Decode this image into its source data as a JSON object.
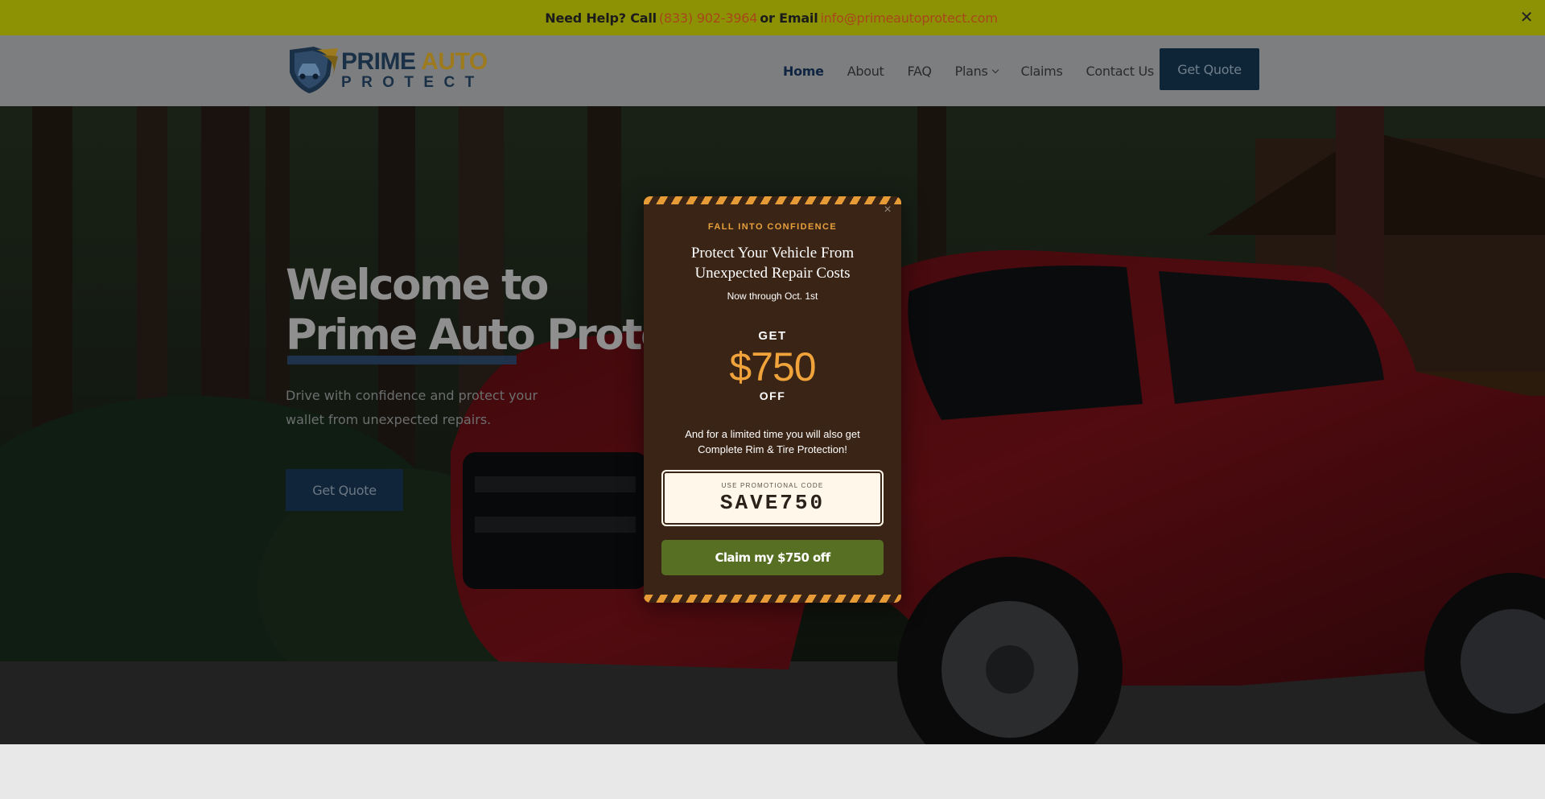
{
  "topbar": {
    "need_help": "Need Help? Call",
    "phone": "(833) 902-3964",
    "or_email": "or Email",
    "email": "info@primeautoprotect.com",
    "close": "✕"
  },
  "header": {
    "logo": {
      "line1_prime": "PRIME",
      "line1_auto": "AUTO",
      "line2": "PROTECT"
    },
    "nav": [
      {
        "label": "Home"
      },
      {
        "label": "About"
      },
      {
        "label": "FAQ"
      },
      {
        "label": "Plans"
      },
      {
        "label": "Claims"
      },
      {
        "label": "Contact Us"
      }
    ],
    "cta": "Get Quote"
  },
  "hero": {
    "title_line1": "Welcome to",
    "title_line2": "Prime Auto Protect",
    "subtitle": "Drive with confidence and protect your wallet from unexpected repairs.",
    "cta": "Get Quote"
  },
  "popup": {
    "close": "×",
    "kicker": "FALL INTO CONFIDENCE",
    "heading": "Protect Your Vehicle From Unexpected Repair Costs",
    "dates": "Now through Oct. 1st",
    "get": "GET",
    "amount": "$750",
    "off": "OFF",
    "note": "And for a limited time you will also get Complete Rim & Tire Protection!",
    "promo_label": "USE PROMOTIONAL CODE",
    "promo_code": "SAVE750",
    "claim_button": "Claim my $750 off"
  },
  "colors": {
    "topbar_bg": "#8d9204",
    "link": "#a8471b",
    "brand_navy": "#1a3047",
    "brand_gold": "#9c7a1d",
    "popup_bg": "#3a2415",
    "popup_accent": "#f0a33a",
    "claim_green": "#566f22"
  }
}
